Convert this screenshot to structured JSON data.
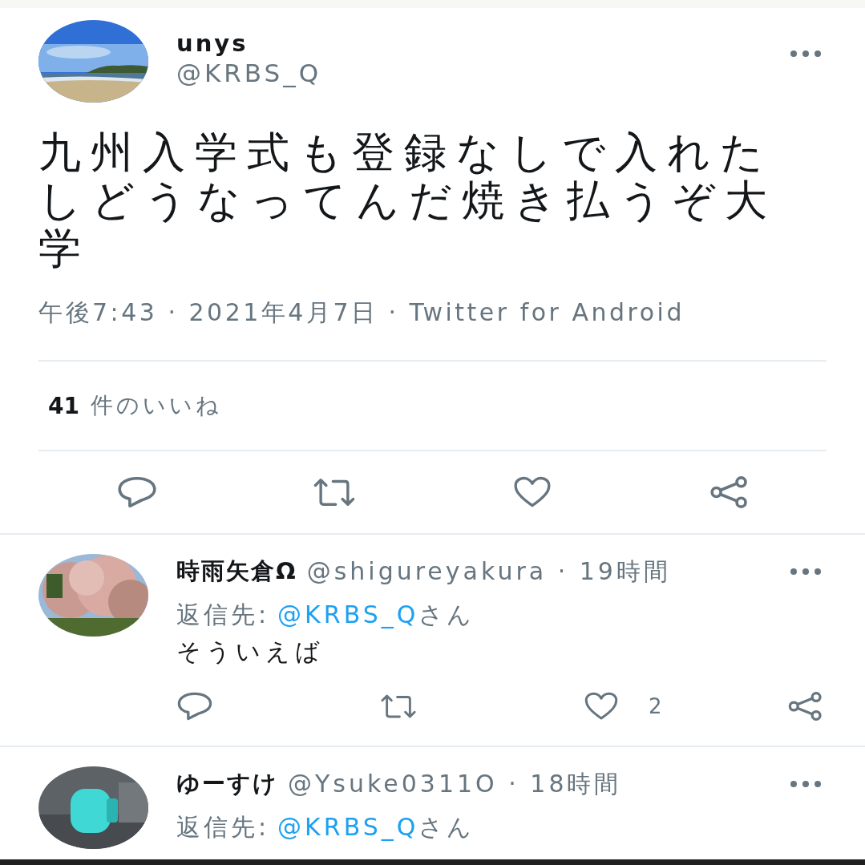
{
  "tweet": {
    "name": "unys",
    "handle": "@KRBS_Q",
    "text": "九州入学式も登録なしで入れたしどうなってんだ焼き払うぞ大学",
    "time": "午後7:43",
    "separator_1": "·",
    "date": "2021年4月7日",
    "separator_2": "·",
    "source": "Twitter for Android",
    "likes_count": "41",
    "likes_label": "件のいいね"
  },
  "replies": [
    {
      "name": "時雨矢倉Ω",
      "handle": "@shigureyakura",
      "separator": "·",
      "time": "19時間",
      "reply_to_label": "返信先:",
      "reply_to_handle": "@KRBS_Q",
      "reply_to_suffix": "さん",
      "text": "そういえば",
      "like_count": "2"
    },
    {
      "name": "ゆーすけ",
      "handle": "@Ysuke0311O",
      "separator": "·",
      "time": "18時間",
      "reply_to_label": "返信先:",
      "reply_to_handle": "@KRBS_Q",
      "reply_to_suffix": "さん"
    }
  ]
}
